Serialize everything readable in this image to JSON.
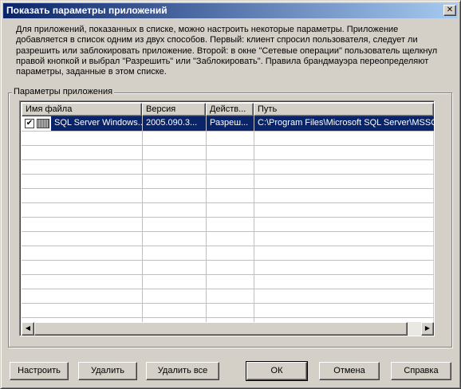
{
  "window": {
    "title": "Показать параметры приложений",
    "close_glyph": "✕"
  },
  "description": "Для приложений, показанных в списке, можно настроить некоторые параметры. Приложение добавляется в список одним из двух способов. Первый: клиент спросил пользователя, следует ли разрешить или заблокировать приложение. Второй: в окне \"Сетевые операции\" пользователь щелкнул правой кнопкой и выбрал \"Разрешить\" или \"Заблокировать\". Правила брандмауэра переопределяют параметры, заданные в этом списке.",
  "group": {
    "label": "Параметры приложения"
  },
  "list": {
    "columns": [
      "Имя файла",
      "Версия",
      "Действ...",
      "Путь"
    ],
    "rows": [
      {
        "checked": true,
        "icon": "application-icon",
        "file_name": "SQL Server Windows...",
        "version": "2005.090.3...",
        "action": "Разреш...",
        "path": "C:\\Program Files\\Microsoft SQL Server\\MSSQL"
      }
    ]
  },
  "scrollbar": {
    "left_arrow": "◀",
    "right_arrow": "▶"
  },
  "buttons": {
    "configure": "Настроить",
    "delete": "Удалить",
    "delete_all": "Удалить все",
    "ok": "ОК",
    "cancel": "Отмена",
    "help": "Справка"
  }
}
